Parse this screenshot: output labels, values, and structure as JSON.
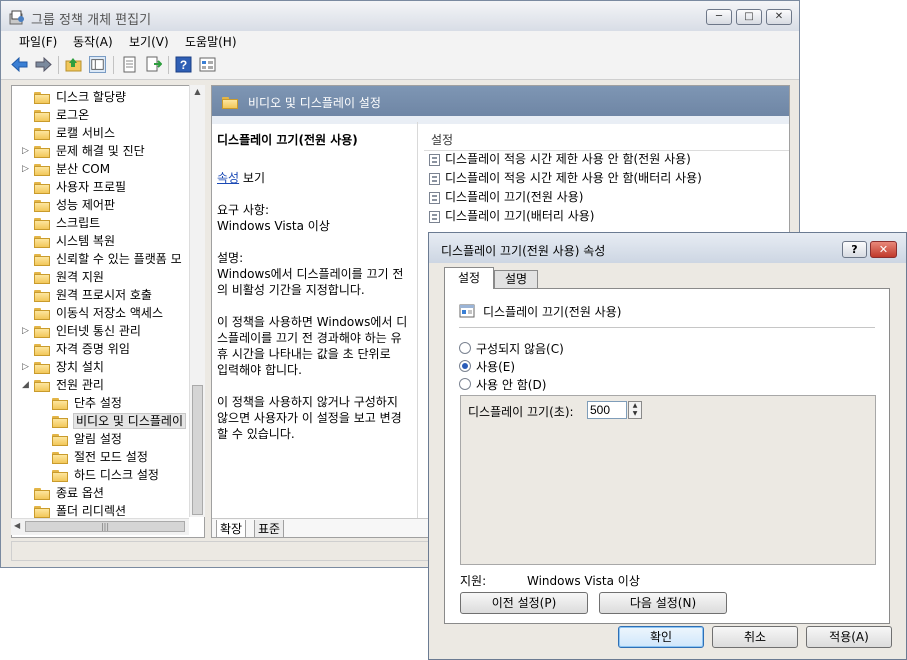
{
  "main_window": {
    "title": "그룹 정책 개체 편집기",
    "controls": {
      "minimize": "─",
      "maximize": "□",
      "close": "✕"
    },
    "menu": [
      "파일(F)",
      "동작(A)",
      "보기(V)",
      "도움말(H)"
    ]
  },
  "tree": {
    "items": [
      {
        "label": "디스크 할당량"
      },
      {
        "label": "로그온"
      },
      {
        "label": "로캘 서비스"
      },
      {
        "label": "문제 해결 및 진단",
        "expander": "▷"
      },
      {
        "label": "분산 COM",
        "expander": "▷"
      },
      {
        "label": "사용자 프로필"
      },
      {
        "label": "성능 제어판"
      },
      {
        "label": "스크립트"
      },
      {
        "label": "시스템 복원"
      },
      {
        "label": "신뢰할 수 있는 플랫폼 모"
      },
      {
        "label": "원격 지원"
      },
      {
        "label": "원격 프로시저 호출"
      },
      {
        "label": "이동식 저장소 액세스"
      },
      {
        "label": "인터넷 통신 관리",
        "expander": "▷"
      },
      {
        "label": "자격 증명 위임"
      },
      {
        "label": "장치 설치",
        "expander": "▷"
      },
      {
        "label": "전원 관리",
        "expander": "◢"
      },
      {
        "label": "단추 설정",
        "child": true
      },
      {
        "label": "비디오 및 디스플레이",
        "child": true,
        "selected": true
      },
      {
        "label": "알림 설정",
        "child": true
      },
      {
        "label": "절전 모드 설정",
        "child": true
      },
      {
        "label": "하드 디스크 설정",
        "child": true
      },
      {
        "label": "종료 옵션"
      },
      {
        "label": "폴더 리디렉션"
      }
    ]
  },
  "pane": {
    "header": "비디오 및 디스플레이 설정",
    "policy_title": "디스플레이 끄기(전원 사용)",
    "properties_link": "속성",
    "properties_suffix": " 보기",
    "requirements_label": "요구 사항:",
    "requirements_value": "Windows Vista 이상",
    "description_label": "설명:",
    "description": [
      "Windows에서 디스플레이를 끄기 전",
      "의 비활성 기간을 지정합니다.",
      "",
      "이 정책을 사용하면 Windows에서 디",
      "스플레이를 끄기 전 경과해야 하는 유",
      "휴 시간을 나타내는 값을 초 단위로",
      "입력해야 합니다.",
      "",
      "이 정책을 사용하지 않거나 구성하지",
      "않으면 사용자가 이 설정을 보고 변경",
      "할 수 있습니다."
    ],
    "settings_header": "설정",
    "settings": [
      "디스플레이  적응 시간 제한 사용 안 함(전원 사용)",
      "디스플레이 적응 시간 제한 사용 안 함(배터리 사용)",
      "디스플레이 끄기(전원 사용)",
      "디스플레이 끄기(배터리 사용)"
    ],
    "tab_extended": "확장",
    "tab_standard": "표준"
  },
  "dialog": {
    "title": "디스플레이 끄기(전원 사용) 속성",
    "help": "?",
    "close": "✕",
    "tabs": [
      "설정",
      "설명"
    ],
    "policy_name": "디스플레이 끄기(전원 사용)",
    "options": [
      "구성되지 않음(C)",
      "사용(E)",
      "사용 안 함(D)"
    ],
    "selected_option": 1,
    "field_label": "디스플레이 끄기(초):",
    "field_value": "500",
    "supported_label": "지원:",
    "supported_value": "Windows Vista 이상",
    "prev_button": "이전 설정(P)",
    "next_button": "다음 설정(N)",
    "ok": "확인",
    "cancel": "취소",
    "apply": "적용(A)"
  }
}
